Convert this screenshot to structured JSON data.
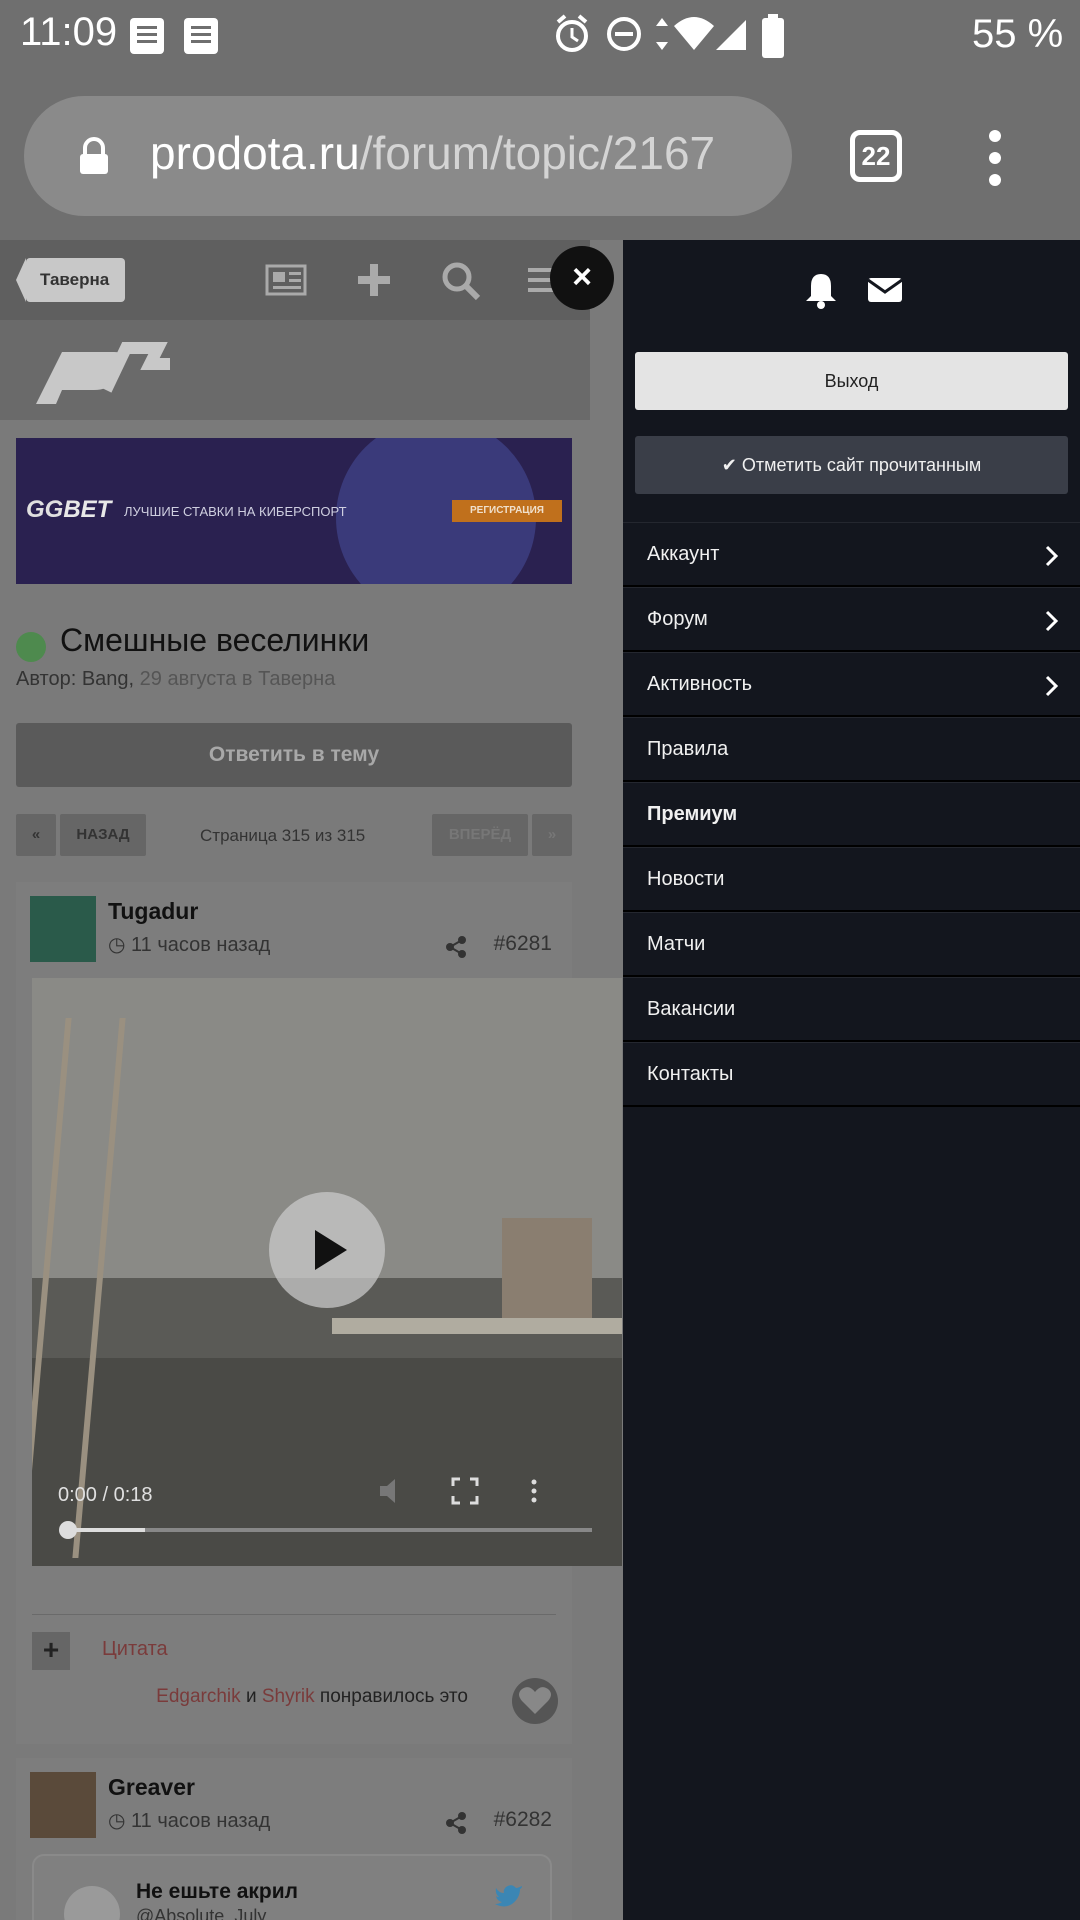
{
  "status_bar": {
    "time": "11:09",
    "battery": "55 %"
  },
  "browser": {
    "domain": "prodota.ru",
    "path": "/forum/topic/2167",
    "tab_count": "22"
  },
  "nav": {
    "breadcrumb": "Таверна",
    "close": "×"
  },
  "ad": {
    "logo_a": "GG",
    "logo_b": "BET",
    "text": "ЛУЧШИЕ СТАВКИ НА КИБЕРСПОРТ",
    "cta": "РЕГИСТРАЦИЯ"
  },
  "topic": {
    "title": "Смешные веселинки",
    "meta_prefix": "Автор: Bang,",
    "meta_rest": "29 августа в Таверна",
    "reply_label": "Ответить в тему"
  },
  "pagination": {
    "back": "НАЗАД",
    "indicator": "Страница 315 из 315",
    "forward": "ВПЕРЁД",
    "first": "«",
    "last": "»"
  },
  "posts": [
    {
      "author": "Tugadur",
      "time": "11 часов назад",
      "number": "#6281",
      "video": {
        "time": "0:00 / 0:18",
        "progress": 0.15
      },
      "quote_label": "Цитата",
      "likes": {
        "user1": "Edgarchik",
        "joiner": "и",
        "user2": "Shyrik",
        "suffix": "понравилось это"
      }
    },
    {
      "author": "Greaver",
      "time": "11 часов назад",
      "number": "#6282",
      "tweet": {
        "author": "Не ешьте акрил",
        "handle": "@Absolute_July"
      }
    }
  ],
  "side_menu": {
    "logout": "Выход",
    "mark_read": "✔ Отметить сайт прочитанным",
    "items": [
      {
        "label": "Аккаунт",
        "has_submenu": true
      },
      {
        "label": "Форум",
        "has_submenu": true
      },
      {
        "label": "Активность",
        "has_submenu": true
      },
      {
        "label": "Правила",
        "has_submenu": false
      },
      {
        "label": "Премиум",
        "has_submenu": false,
        "bold": true
      },
      {
        "label": "Новости",
        "has_submenu": false
      },
      {
        "label": "Матчи",
        "has_submenu": false
      },
      {
        "label": "Вакансии",
        "has_submenu": false
      },
      {
        "label": "Контакты",
        "has_submenu": false
      }
    ]
  },
  "colors": {
    "menu_bg": "#13161e",
    "link_red": "#7a3b3b",
    "twitter_blue": "#1da1f2"
  }
}
